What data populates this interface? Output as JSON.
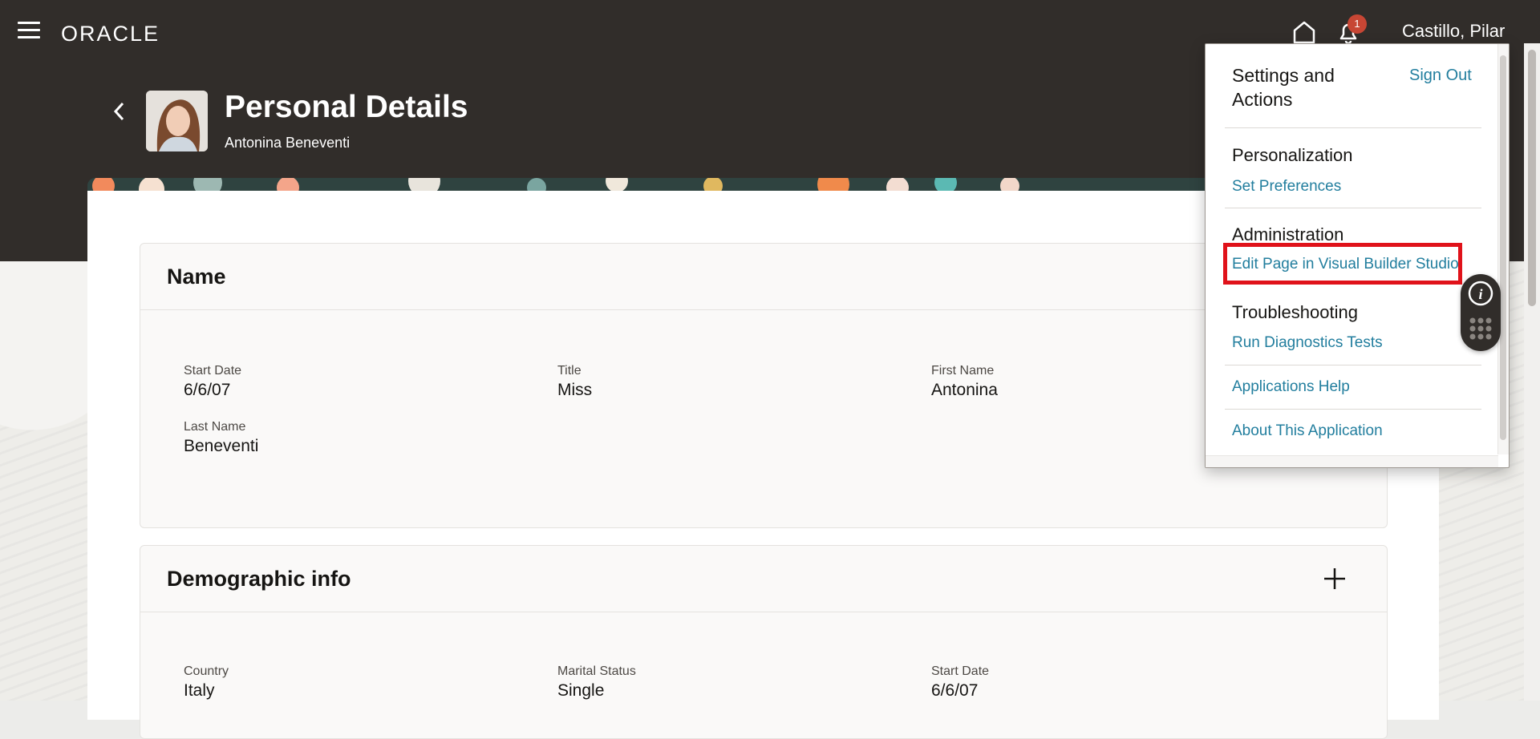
{
  "topbar": {
    "logo_text": "ORACLE",
    "notification_count": "1",
    "user_name": "Castillo, Pilar"
  },
  "page": {
    "title": "Personal Details",
    "subtitle": "Antonina Beneventi"
  },
  "sections": {
    "name": {
      "title": "Name",
      "fields": [
        {
          "label": "Start Date",
          "value": "6/6/07"
        },
        {
          "label": "Title",
          "value": "Miss"
        },
        {
          "label": "First Name",
          "value": "Antonina"
        },
        {
          "label": "Last Name",
          "value": "Beneventi"
        }
      ]
    },
    "demographic": {
      "title": "Demographic info",
      "fields": [
        {
          "label": "Country",
          "value": "Italy"
        },
        {
          "label": "Marital Status",
          "value": "Single"
        },
        {
          "label": "Start Date",
          "value": "6/6/07"
        }
      ]
    }
  },
  "popup": {
    "title": "Settings and Actions",
    "sign_out": "Sign Out",
    "groups": [
      {
        "heading": "Personalization",
        "link": "Set Preferences"
      },
      {
        "heading": "Administration",
        "link": "Edit Page in Visual Builder Studio"
      },
      {
        "heading": "Troubleshooting",
        "link": "Run Diagnostics Tests"
      }
    ],
    "applications_help": "Applications Help",
    "about": "About This Application"
  },
  "colors": {
    "header_bg": "#312d2a",
    "link": "#227e9e",
    "badge": "#c74634",
    "highlight": "#e0121a"
  }
}
